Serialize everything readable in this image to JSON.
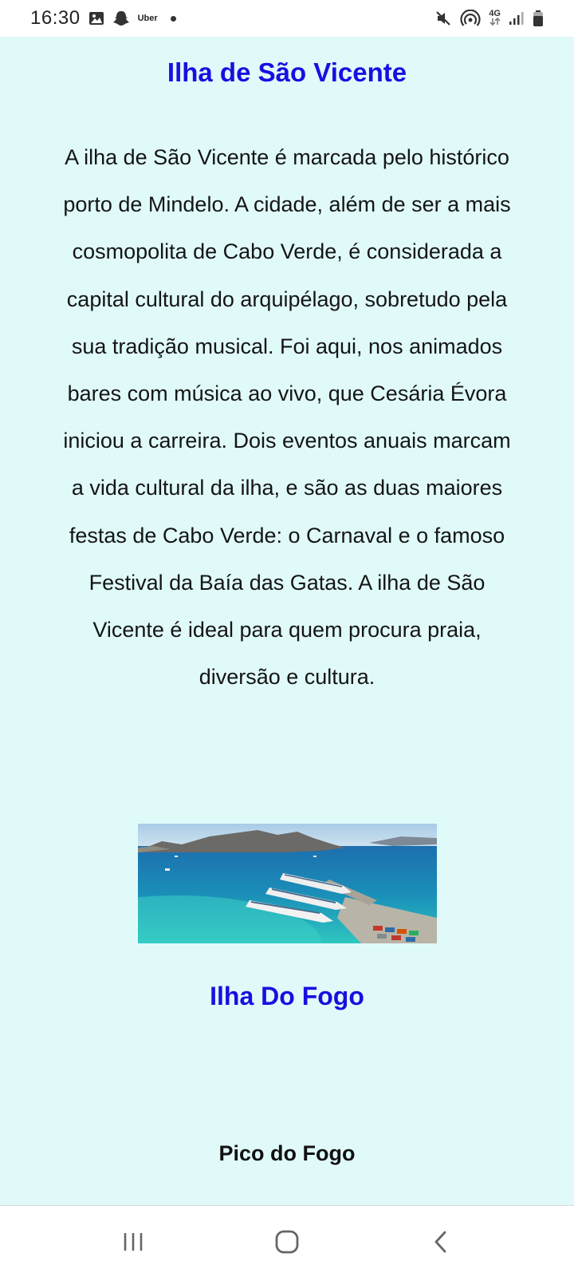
{
  "status_bar": {
    "time": "16:30",
    "app_label": "Uber",
    "network": "4G",
    "icons": [
      "image-icon",
      "snapchat-icon",
      "uber-icon",
      "notification-dot",
      "mute-icon",
      "hotspot-icon",
      "4g-icon",
      "signal-icon",
      "battery-icon"
    ]
  },
  "sections": {
    "sao_vicente": {
      "title": "Ilha de São Vicente",
      "paragraph": "A ilha de São Vicente é marcada pelo histórico porto de Mindelo. A cidade, além de ser a mais cosmopolita de Cabo Verde, é considerada a capital cultural do arquipélago, sobretudo pela sua tradição musical. Foi aqui, nos animados bares com música ao vivo, que Cesária Évora iniciou a carreira. Dois eventos anuais marcam a vida cultural da ilha, e são as duas maiores festas de Cabo Verde: o Carnaval e o famoso Festival da Baía das Gatas. A ilha de São Vicente é ideal para quem procura praia, diversão e cultura."
    },
    "fogo": {
      "title": "Ilha Do Fogo",
      "subtitle": "Pico do Fogo"
    }
  },
  "colors": {
    "background": "#e0fafa",
    "heading_blue": "#1a0ee0",
    "text": "#151515"
  },
  "nav_bar": {
    "icons": [
      "recent-apps-icon",
      "home-icon",
      "back-icon"
    ]
  }
}
